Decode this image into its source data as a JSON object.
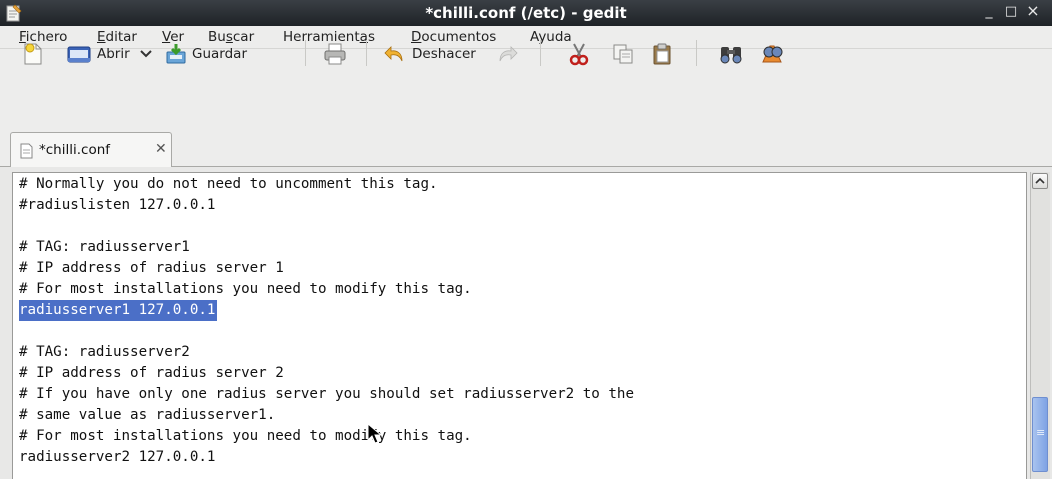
{
  "window": {
    "title": "*chilli.conf (/etc) - gedit",
    "minimize_glyph": "_",
    "maximize_glyph": "□",
    "close_glyph": "×"
  },
  "menu": [
    "Fichero",
    "Editar",
    "Ver",
    "Buscar",
    "Herramientas",
    "Documentos",
    "Ayuda"
  ],
  "toolbar": {
    "new_icon": "new-document-icon",
    "open_label": "Abrir",
    "save_label": "Guardar",
    "print_icon": "print-icon",
    "undo_label": "Deshacer",
    "redo_icon": "redo-icon",
    "cut_icon": "cut-icon",
    "copy_icon": "copy-icon",
    "paste_icon": "paste-icon",
    "find_icon": "find-icon",
    "replace_icon": "find-replace-icon"
  },
  "tab": {
    "label": "*chilli.conf",
    "close_glyph": "✕"
  },
  "editor": {
    "lines": [
      "# Normally you do not need to uncomment this tag.",
      "#radiuslisten 127.0.0.1",
      "",
      "# TAG: radiusserver1",
      "# IP address of radius server 1",
      "# For most installations you need to modify this tag.",
      "radiusserver1 127.0.0.1",
      "",
      "# TAG: radiusserver2",
      "# IP address of radius server 2",
      "# If you have only one radius server you should set radiusserver2 to the",
      "# same value as radiusserver1.",
      "# For most installations you need to modify this tag.",
      "radiusserver2 127.0.0.1"
    ],
    "selected_line_index": 6,
    "selection_color": "#4b6fc7"
  },
  "scrollbar": {
    "thumb_grip": "≡"
  }
}
